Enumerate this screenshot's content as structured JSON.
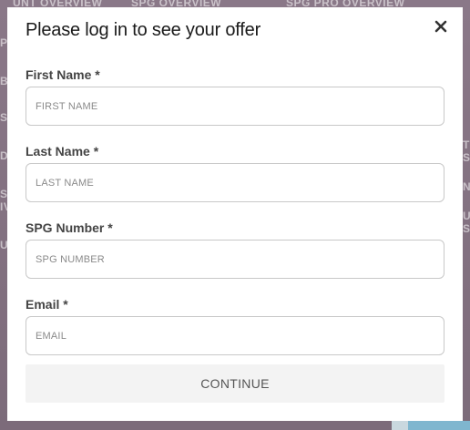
{
  "background": {
    "fragments": [
      "UNT OVERVIEW",
      "SPG OVERVIEW",
      "SPG PRO OVERVIEW",
      "PI",
      "BE",
      "ST",
      "D A",
      "ST",
      "IV",
      "U",
      "T",
      "S",
      "N",
      "U",
      "S"
    ]
  },
  "modal": {
    "title": "Please log in to see your offer",
    "close_icon": "close-icon",
    "fields": [
      {
        "label": "First Name *",
        "placeholder": "FIRST NAME",
        "value": ""
      },
      {
        "label": "Last Name *",
        "placeholder": "LAST NAME",
        "value": ""
      },
      {
        "label": "SPG Number *",
        "placeholder": "SPG NUMBER",
        "value": ""
      },
      {
        "label": "Email *",
        "placeholder": "EMAIL",
        "value": ""
      }
    ],
    "continue_label": "CONTINUE"
  },
  "colors": {
    "overlay": "#7f6f7d",
    "modal_bg": "#ffffff",
    "label_text": "#444444",
    "input_border": "#c8c8c8",
    "button_bg": "#f3f3f3",
    "button_text": "#555555"
  }
}
